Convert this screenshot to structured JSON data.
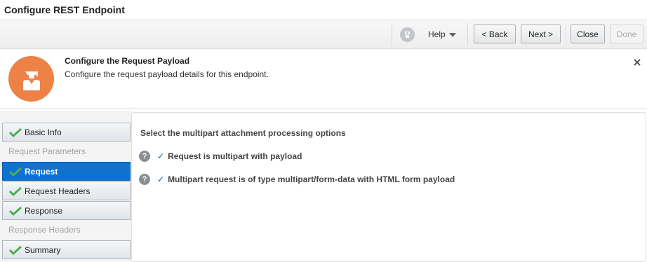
{
  "window": {
    "title": "Configure REST Endpoint"
  },
  "toolbar": {
    "help_label": "Help",
    "back_label": "< Back",
    "next_label": "Next >",
    "close_label": "Close",
    "done_label": "Done"
  },
  "info": {
    "title": "Configure the Request Payload",
    "description": "Configure the request payload details for this endpoint."
  },
  "sidebar": {
    "basic_info": "Basic Info",
    "request_params_group": "Request Parameters",
    "request": "Request",
    "request_headers": "Request Headers",
    "response": "Response",
    "response_headers_group": "Response Headers",
    "summary": "Summary"
  },
  "main": {
    "heading": "Select the multipart attachment processing options",
    "options": [
      {
        "check": "✓",
        "label": "Request is multipart with payload"
      },
      {
        "check": "✓",
        "label": "Multipart request is of type multipart/form-data with HTML form payload"
      }
    ],
    "help_glyph": "?"
  },
  "colors": {
    "accent_orange": "#ee8145",
    "selected_blue": "#0d72d1",
    "check_green": "#4caf50"
  },
  "icons": [
    "help-icon",
    "help-dropdown-caret-icon",
    "wizard-avatar-icon",
    "close-icon",
    "checkmark-icon",
    "question-icon"
  ]
}
